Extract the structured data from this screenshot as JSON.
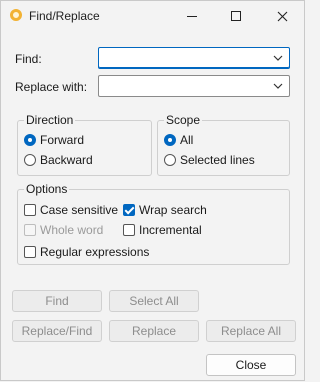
{
  "window": {
    "title": "Find/Replace"
  },
  "find": {
    "label": "Find:",
    "value": ""
  },
  "replace": {
    "label": "Replace with:",
    "value": ""
  },
  "direction": {
    "title": "Direction",
    "options": [
      "Forward",
      "Backward"
    ],
    "selected": "Forward"
  },
  "scope": {
    "title": "Scope",
    "options": [
      "All",
      "Selected lines"
    ],
    "selected": "All"
  },
  "options": {
    "title": "Options",
    "case_sensitive": "Case sensitive",
    "wrap_search": "Wrap search",
    "whole_word": "Whole word",
    "incremental": "Incremental",
    "regex": "Regular expressions"
  },
  "buttons": {
    "find": "Find",
    "select_all": "Select All",
    "replace_find": "Replace/Find",
    "replace": "Replace",
    "replace_all": "Replace All",
    "close": "Close"
  },
  "colors": {
    "accent": "#0067c0",
    "icon": "#f2b233"
  }
}
